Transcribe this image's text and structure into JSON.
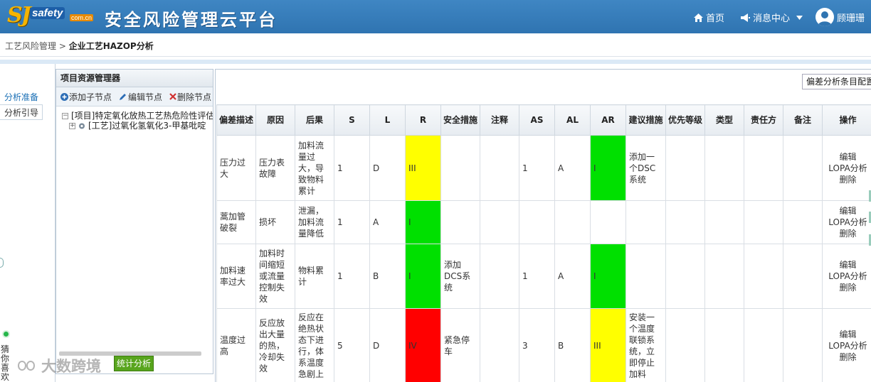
{
  "header": {
    "logo_main": "SJ",
    "logo_word": "safety",
    "logo_domain": "com.cn",
    "app_title": "安全风险管理云平台",
    "nav_home": "首页",
    "nav_messages": "消息中心",
    "user_name": "顾珊珊"
  },
  "breadcrumb": {
    "parent": "工艺风险管理",
    "separator": " > ",
    "current": "企业工艺HAZOP分析"
  },
  "left_rail": {
    "tab_active": "分析准备",
    "tab_other": "分析引导",
    "side_widget": "猜你喜欢"
  },
  "watermark": "大数跨境",
  "resource_panel": {
    "title": "项目资源管理器",
    "add_child": "添加子节点",
    "edit_node": "编辑节点",
    "delete_node": "删除节点",
    "tree": [
      "[项目]特定氧化放热工艺热危险性评估",
      "[工艺]过氧化氢氧化3-甲基吡啶"
    ],
    "stat_button": "统计分析"
  },
  "main": {
    "config_button": "偏差分析条目配置",
    "columns": [
      "偏差描述",
      "原因",
      "后果",
      "S",
      "L",
      "R",
      "安全措施",
      "注释",
      "AS",
      "AL",
      "AR",
      "建议措施",
      "优先等级",
      "类型",
      "责任方",
      "备注",
      "操作"
    ],
    "rows": [
      {
        "dev": "压力过大",
        "cause": "压力表故障",
        "conseq": "加料流量过大，导致物料累计",
        "s": "1",
        "l": "D",
        "r": "III",
        "r_color": "#ffff00",
        "measure": "",
        "note": "",
        "as": "1",
        "al": "A",
        "ar": "I",
        "ar_color": "#00e000",
        "suggest": "添加一个DSC系统"
      },
      {
        "dev": "蒿加管破裂",
        "cause": "损坏",
        "conseq": "泄漏，加料流量降低",
        "s": "1",
        "l": "A",
        "r": "I",
        "r_color": "#00e000",
        "measure": "",
        "note": "",
        "as": "",
        "al": "",
        "ar": "",
        "ar_color": "",
        "suggest": ""
      },
      {
        "dev": "加料速率过大",
        "cause": "加料时间缩短或流量控制失效",
        "conseq": "物料累计",
        "s": "1",
        "l": "B",
        "r": "I",
        "r_color": "#00e000",
        "measure": "添加DCS系统",
        "note": "",
        "as": "1",
        "al": "A",
        "ar": "I",
        "ar_color": "#00e000",
        "suggest": ""
      },
      {
        "dev": "温度过高",
        "cause": "反应放出大量的热，冷却失效",
        "conseq": "反应在绝热状态下进行，体系温度急剧上",
        "s": "5",
        "l": "D",
        "r": "IV",
        "r_color": "#ff0000",
        "measure": "紧急停车",
        "note": "",
        "as": "3",
        "al": "B",
        "ar": "III",
        "ar_color": "#ffff00",
        "suggest": "安装一个温度联锁系统，立即停止加料"
      }
    ],
    "ops": {
      "edit": "编辑",
      "lopa": "LOPA分析",
      "delete": "删除"
    }
  }
}
